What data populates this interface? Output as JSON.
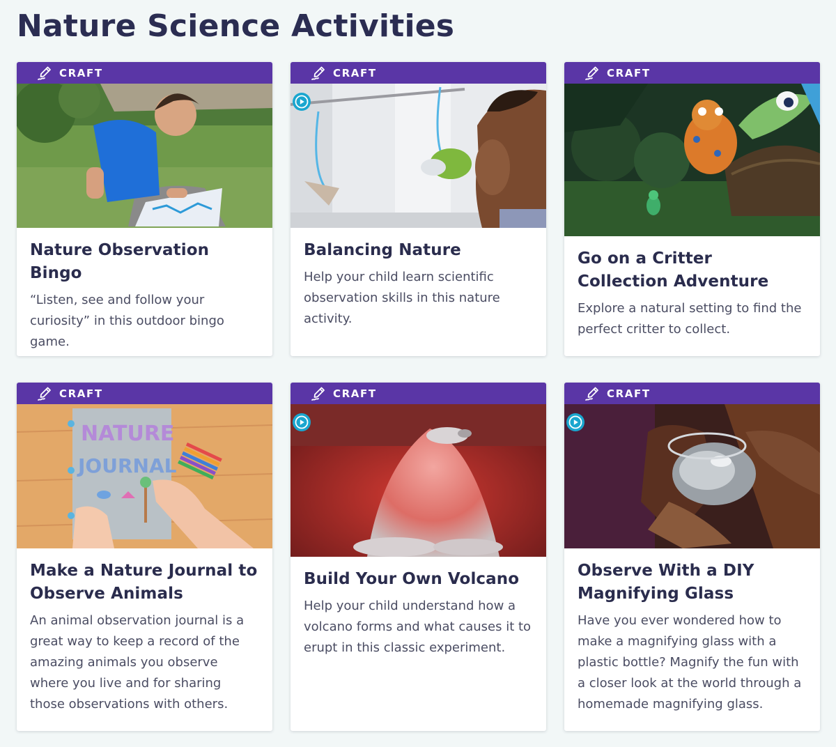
{
  "page": {
    "title": "Nature Science Activities"
  },
  "colors": {
    "tag_background": "#5a36a6",
    "page_background": "#f2f7f7",
    "play_badge": "#1aa6cf"
  },
  "cards": [
    {
      "tag": "CRAFT",
      "tag_icon": "marker-pen-icon",
      "has_video": false,
      "image": "child drawing on a bingo card outdoors on the grass",
      "title": "Nature Observation Bingo",
      "description": "“Listen, see and follow your curiosity” in this outdoor bingo game."
    },
    {
      "tag": "CRAFT",
      "tag_icon": "marker-pen-icon",
      "has_video": true,
      "image": "boy looking at hanging plant balances",
      "title": "Balancing Nature",
      "description": "Help your child learn scientific observation skills in this nature activity."
    },
    {
      "tag": "CRAFT",
      "tag_icon": "marker-pen-icon",
      "has_video": false,
      "image": "cartoon dinosaurs in a jungle with a small lizard",
      "title": "Go on a Critter Collection Adventure",
      "description": "Explore a natural setting to find the perfect critter to collect."
    },
    {
      "tag": "CRAFT",
      "tag_icon": "marker-pen-icon",
      "has_video": false,
      "image": "hand drawing a nature journal cover with crayons",
      "title": "Make a Nature Journal to Observe Animals",
      "description": "An animal observation journal is a great way to keep a record of the amazing animals you observe where you live and for sharing those observations with others.",
      "image_text": [
        "NATURE",
        "JOURNAL"
      ]
    },
    {
      "tag": "CRAFT",
      "tag_icon": "marker-pen-icon",
      "has_video": true,
      "image": "foaming model volcano on red background",
      "title": "Build Your Own Volcano",
      "description": "Help your child understand how a volcano forms and what causes it to erupt in this classic experiment."
    },
    {
      "tag": "CRAFT",
      "tag_icon": "marker-pen-icon",
      "has_video": true,
      "image": "hands holding a homemade magnifying glass over a rock",
      "title": "Observe With a DIY Magnifying Glass",
      "description": "Have you ever wondered how to make a magnifying glass with a plastic bottle? Magnify the fun with a closer look at the world through a homemade magnifying glass."
    }
  ]
}
